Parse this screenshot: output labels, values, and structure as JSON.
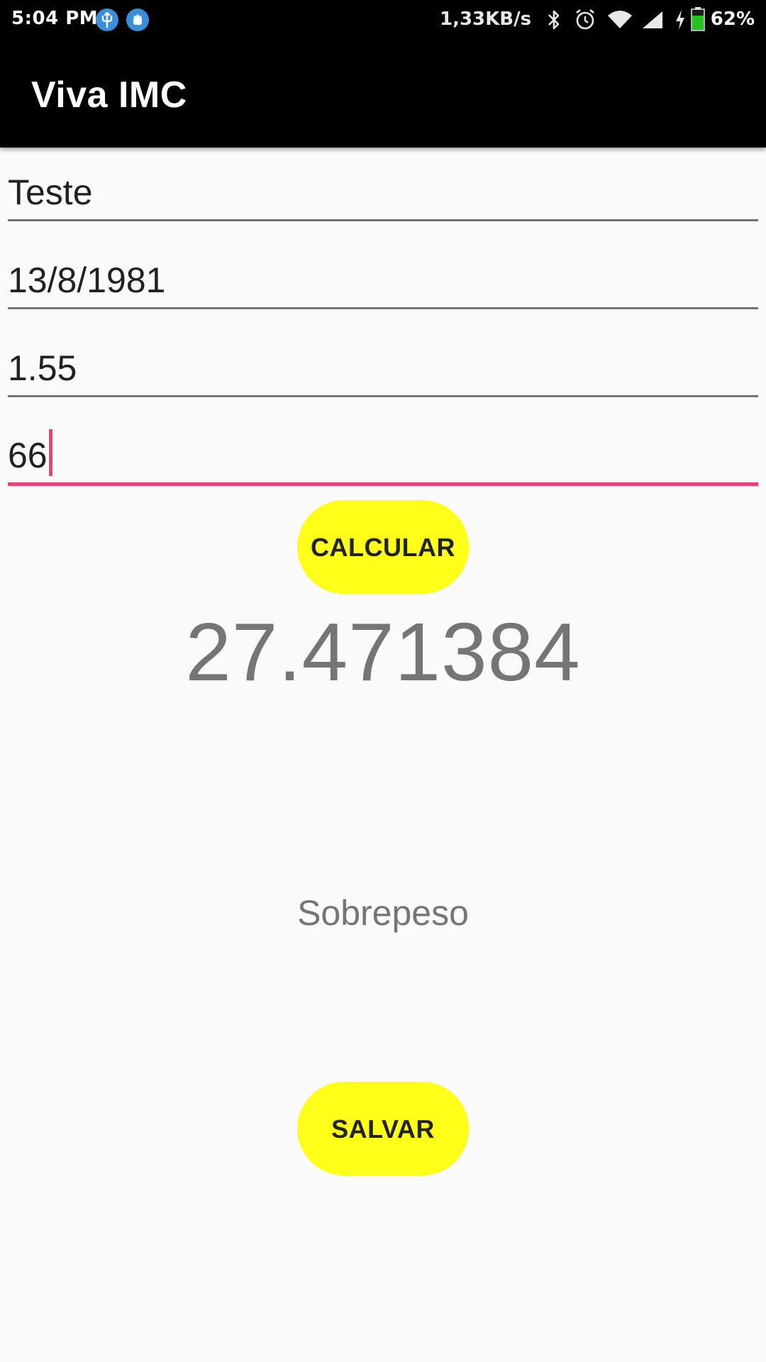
{
  "status_bar": {
    "time": "5:04 PM",
    "net_speed": "1,33KB/s",
    "battery": "62%",
    "icons": [
      "usb-icon",
      "android-debug-icon",
      "bluetooth-icon",
      "alarm-icon",
      "wifi-icon",
      "signal-icon",
      "charging-icon",
      "battery-icon"
    ],
    "battery_color": "#22c51e"
  },
  "app_bar": {
    "title": "Viva IMC"
  },
  "form": {
    "name": "Teste",
    "birth_date": "13/8/1981",
    "height": "1.55",
    "weight": "66"
  },
  "actions": {
    "calculate_label": "CALCULAR",
    "save_label": "SALVAR"
  },
  "result": {
    "value": "27.471384",
    "classification": "Sobrepeso"
  },
  "colors": {
    "accent": "#ec407a",
    "button": "#ffff1a",
    "app_bar": "#000000",
    "background": "#fafafa"
  }
}
